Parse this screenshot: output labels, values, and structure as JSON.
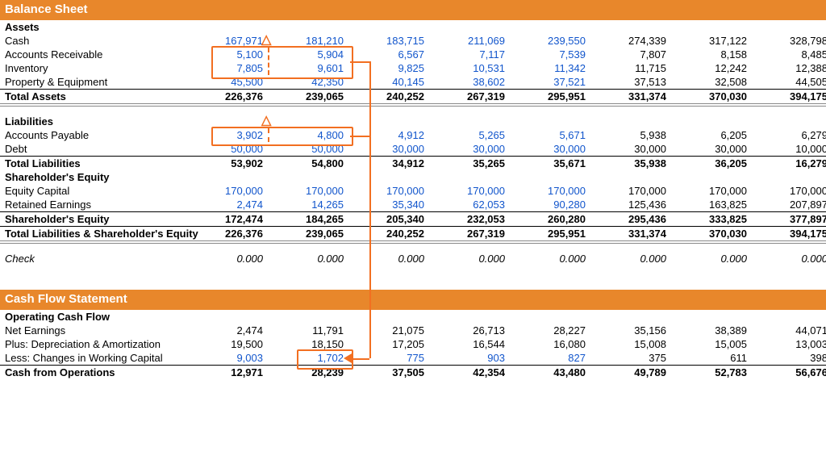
{
  "sections": {
    "balance_sheet": "Balance Sheet",
    "cash_flow": "Cash Flow Statement"
  },
  "bs": {
    "assets_header": "Assets",
    "rows": {
      "cash": {
        "label": "Cash",
        "v": [
          "167,971",
          "181,210",
          "183,715",
          "211,069",
          "239,550",
          "274,339",
          "317,122",
          "328,798"
        ],
        "blue_upto": 5
      },
      "ar": {
        "label": "Accounts Receivable",
        "v": [
          "5,100",
          "5,904",
          "6,567",
          "7,117",
          "7,539",
          "7,807",
          "8,158",
          "8,485"
        ],
        "blue_upto": 5
      },
      "inv": {
        "label": "Inventory",
        "v": [
          "7,805",
          "9,601",
          "9,825",
          "10,531",
          "11,342",
          "11,715",
          "12,242",
          "12,388"
        ],
        "blue_upto": 5
      },
      "ppe": {
        "label": "Property & Equipment",
        "v": [
          "45,500",
          "42,350",
          "40,145",
          "38,602",
          "37,521",
          "37,513",
          "32,508",
          "44,505"
        ],
        "blue_upto": 5
      },
      "ta": {
        "label": "Total Assets",
        "v": [
          "226,376",
          "239,065",
          "240,252",
          "267,319",
          "295,951",
          "331,374",
          "370,030",
          "394,175"
        ]
      }
    },
    "liab_header": "Liabilities",
    "liab": {
      "ap": {
        "label": "Accounts Payable",
        "v": [
          "3,902",
          "4,800",
          "4,912",
          "5,265",
          "5,671",
          "5,938",
          "6,205",
          "6,279"
        ],
        "blue_upto": 5
      },
      "debt": {
        "label": "Debt",
        "v": [
          "50,000",
          "50,000",
          "30,000",
          "30,000",
          "30,000",
          "30,000",
          "30,000",
          "10,000"
        ],
        "blue_upto": 5
      },
      "tl": {
        "label": "Total Liabilities",
        "v": [
          "53,902",
          "54,800",
          "34,912",
          "35,265",
          "35,671",
          "35,938",
          "36,205",
          "16,279"
        ]
      }
    },
    "eq_header": "Shareholder's Equity",
    "eq": {
      "cap": {
        "label": "Equity Capital",
        "v": [
          "170,000",
          "170,000",
          "170,000",
          "170,000",
          "170,000",
          "170,000",
          "170,000",
          "170,000"
        ],
        "blue_upto": 5
      },
      "re": {
        "label": "Retained Earnings",
        "v": [
          "2,474",
          "14,265",
          "35,340",
          "62,053",
          "90,280",
          "125,436",
          "163,825",
          "207,897"
        ],
        "blue_upto": 5
      },
      "se": {
        "label": "Shareholder's Equity",
        "v": [
          "172,474",
          "184,265",
          "205,340",
          "232,053",
          "260,280",
          "295,436",
          "333,825",
          "377,897"
        ]
      },
      "tle": {
        "label": "Total Liabilities & Shareholder's Equity",
        "v": [
          "226,376",
          "239,065",
          "240,252",
          "267,319",
          "295,951",
          "331,374",
          "370,030",
          "394,175"
        ]
      }
    },
    "check": {
      "label": "Check",
      "v": [
        "0.000",
        "0.000",
        "0.000",
        "0.000",
        "0.000",
        "0.000",
        "0.000",
        "0.000"
      ]
    }
  },
  "cf": {
    "ocf_header": "Operating Cash Flow",
    "rows": {
      "ne": {
        "label": "Net Earnings",
        "v": [
          "2,474",
          "11,791",
          "21,075",
          "26,713",
          "28,227",
          "35,156",
          "38,389",
          "44,071"
        ]
      },
      "da": {
        "label": "Plus: Depreciation & Amortization",
        "v": [
          "19,500",
          "18,150",
          "17,205",
          "16,544",
          "16,080",
          "15,008",
          "15,005",
          "13,003"
        ]
      },
      "wc": {
        "label": "Less: Changes in Working Capital",
        "v": [
          "9,003",
          "1,702",
          "775",
          "903",
          "827",
          "375",
          "611",
          "398"
        ],
        "blue_upto": 5
      },
      "cfo": {
        "label": "Cash from Operations",
        "v": [
          "12,971",
          "28,239",
          "37,505",
          "42,354",
          "43,480",
          "49,789",
          "52,783",
          "56,676"
        ]
      }
    }
  },
  "annotations": {
    "delta_symbol": "△"
  }
}
